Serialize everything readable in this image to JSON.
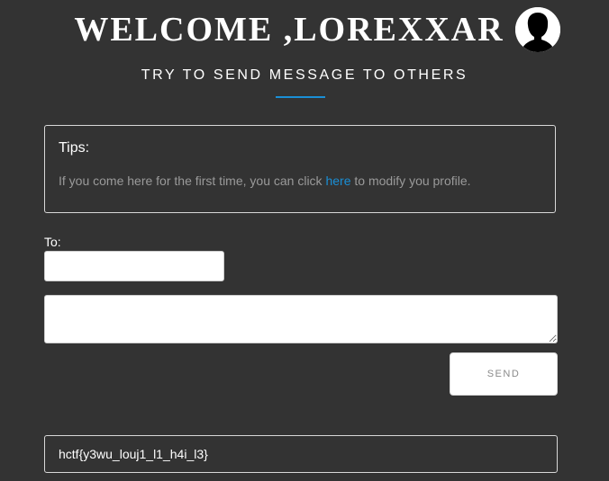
{
  "header": {
    "welcome_title": "WELCOME ,LOREXXAR",
    "subtitle": "TRY TO SEND MESSAGE TO OTHERS",
    "avatar_icon": "user-silhouette-icon",
    "accent_color": "#1a8fd6"
  },
  "tips": {
    "heading": "Tips:",
    "text_before": "If you come here for the first time, you can click ",
    "link_label": "here",
    "text_after": " to modify you profile."
  },
  "send_form": {
    "to_label": "To:",
    "to_value": "",
    "message_value": "",
    "send_label": "SEND"
  },
  "messages": [
    {
      "text": "hctf{y3wu_louj1_l1_h4i_l3}"
    }
  ]
}
